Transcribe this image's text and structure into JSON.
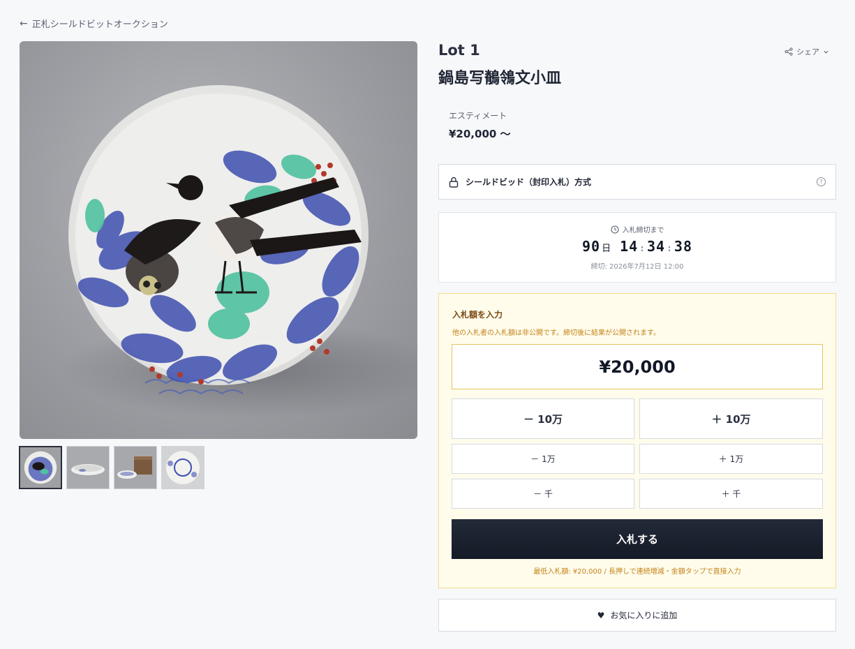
{
  "nav": {
    "back_arrow": "←",
    "back_label": "正札シールドビットオークション"
  },
  "lot": {
    "number": "Lot 1",
    "title": "鍋島写鶺鴒文小皿",
    "share_label": "シェア",
    "estimate_label": "エスティメート",
    "estimate_value": "¥20,000 〜"
  },
  "gallery": {
    "main_image": "blue-and-white-porcelain-plate-with-magpies",
    "thumbnails": [
      {
        "name": "plate-top-view",
        "active": true
      },
      {
        "name": "plate-side-view",
        "active": false
      },
      {
        "name": "plate-with-wooden-box",
        "active": false
      },
      {
        "name": "plate-underside-view",
        "active": false
      }
    ]
  },
  "method": {
    "label": "シールドビッド（封印入札）方式",
    "help_glyph": "?"
  },
  "timer": {
    "label": "入札締切まで",
    "days": "90",
    "days_unit": "日",
    "hours": "14",
    "minutes": "34",
    "seconds": "38",
    "separator": ":",
    "deadline": "締切: 2026年7月12日 12:00"
  },
  "bid": {
    "title": "入札額を入力",
    "note": "他の入札者の入札額は非公開です。締切後に結果が公開されます。",
    "amount": "¥20,000",
    "buttons": {
      "minus_100k": "－ 10万",
      "plus_100k": "＋ 10万",
      "minus_10k": "－ 1万",
      "plus_10k": "＋ 1万",
      "minus_1k": "－ 千",
      "plus_1k": "＋ 千"
    },
    "submit_label": "入札する",
    "footnote": "最低入札額: ¥20,000 / 長押しで連続増減・金額タップで直接入力"
  },
  "favorite": {
    "icon_glyph": "♥",
    "label": "お気に入りに追加"
  },
  "colors": {
    "accent_dark": "#1b2230",
    "panel_bg": "#fffcec",
    "panel_border": "#f3dd89",
    "note_text": "#c48318"
  }
}
